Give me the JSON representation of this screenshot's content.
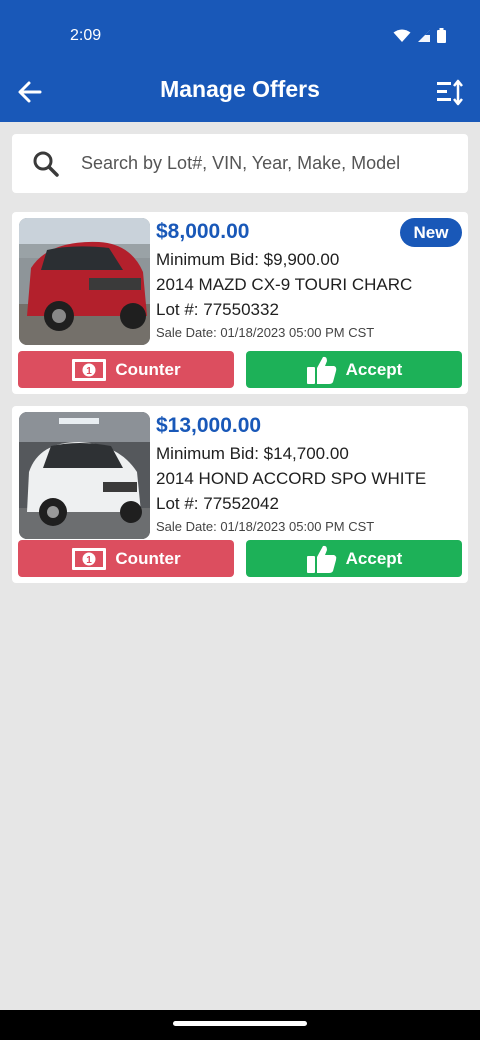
{
  "status_bar": {
    "time": "2:09"
  },
  "header": {
    "title": "Manage Offers"
  },
  "search": {
    "placeholder": "Search by Lot#, VIN, Year, Make, Model"
  },
  "offers": [
    {
      "price": "$8,000.00",
      "min_bid": "Minimum Bid: $9,900.00",
      "vehicle": "2014 MAZD CX-9 TOURI CHARC",
      "lot": "Lot #: 77550332",
      "sale_date": "Sale Date: 01/18/2023 05:00 PM CST",
      "badge": "New",
      "counter_label": "Counter",
      "accept_label": "Accept"
    },
    {
      "price": "$13,000.00",
      "min_bid": "Minimum Bid: $14,700.00",
      "vehicle": "2014 HOND ACCORD SPO WHITE",
      "lot": "Lot #: 77552042",
      "sale_date": "Sale Date: 01/18/2023 05:00 PM CST",
      "counter_label": "Counter",
      "accept_label": "Accept"
    }
  ],
  "colors": {
    "primary": "#1958b8",
    "counter": "#dc4e5f",
    "accept": "#1db158",
    "background": "#e6e6e6"
  }
}
